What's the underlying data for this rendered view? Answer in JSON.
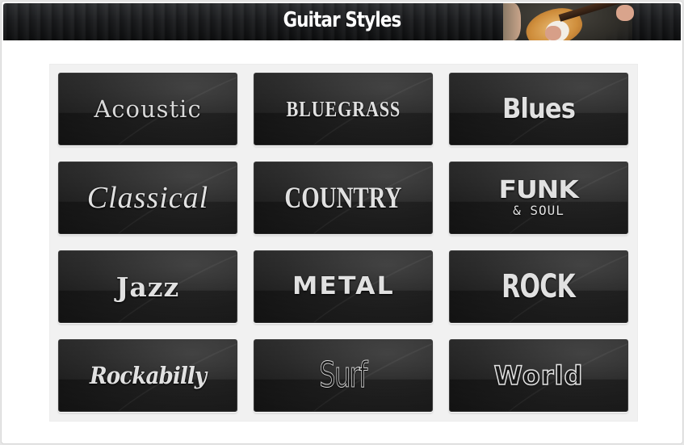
{
  "header": {
    "title": "Guitar Styles",
    "banner_image": "guitarist-playing-electric-guitar"
  },
  "styles": [
    {
      "id": "acoustic",
      "label": "Acoustic"
    },
    {
      "id": "bluegrass",
      "label": "BLUEGRASS"
    },
    {
      "id": "blues",
      "label": "Blues"
    },
    {
      "id": "classical",
      "label": "Classical"
    },
    {
      "id": "country",
      "label": "COUNTRY"
    },
    {
      "id": "funk-soul",
      "label": "FUNK",
      "sublabel": "& SOUL"
    },
    {
      "id": "jazz",
      "label": "Jazz"
    },
    {
      "id": "metal",
      "label": "METAL"
    },
    {
      "id": "rock",
      "label": "ROCK"
    },
    {
      "id": "rockabilly",
      "label": "Rockabilly"
    },
    {
      "id": "surf",
      "label": "Surf"
    },
    {
      "id": "world",
      "label": "World"
    }
  ],
  "colors": {
    "banner_bg": "#1a1b1d",
    "tile_bg": "#1c1c1c",
    "tile_text": "#e1e1e1",
    "panel_bg": "#f1f1f1"
  }
}
